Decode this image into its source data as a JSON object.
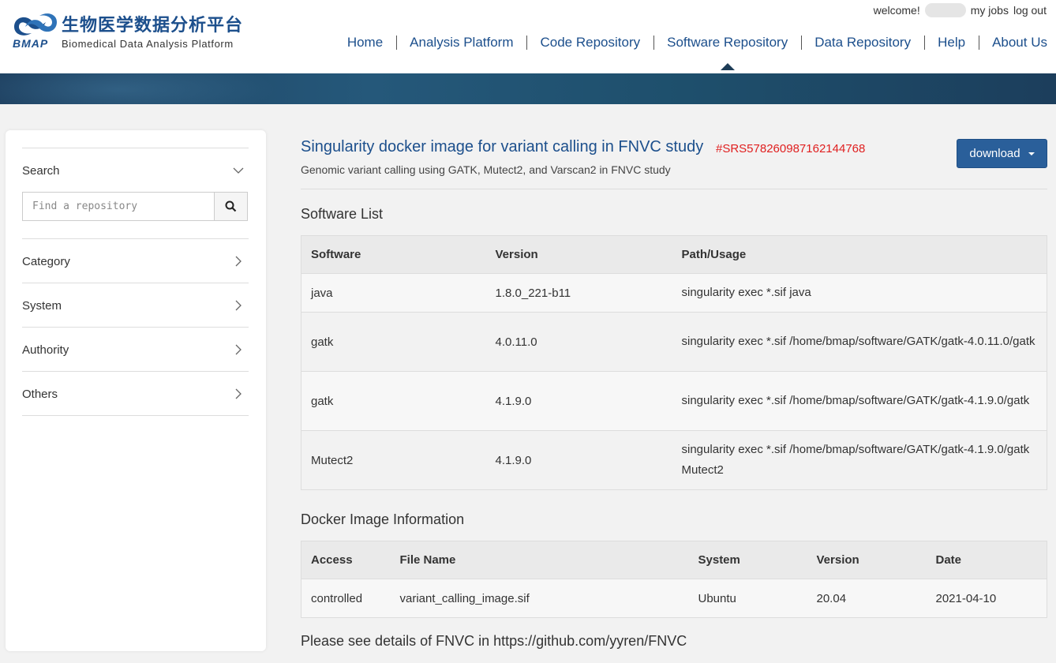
{
  "header": {
    "logo_cn": "生物医学数据分析平台",
    "logo_abbr": "BMAP",
    "logo_en": "Biomedical Data Analysis Platform",
    "welcome": "welcome!",
    "my_jobs": "my jobs",
    "log_out": "log out",
    "nav": [
      "Home",
      "Analysis Platform",
      "Code Repository",
      "Software Repository",
      "Data Repository",
      "Help",
      "About Us"
    ],
    "active_nav": "Software Repository"
  },
  "sidebar": {
    "search_label": "Search",
    "search_placeholder": "Find a repository",
    "filters": [
      "Category",
      "System",
      "Authority",
      "Others"
    ]
  },
  "main": {
    "title": "Singularity docker image for variant calling in FNVC study",
    "id": "#SRS578260987162144768",
    "subtitle": "Genomic variant calling using GATK, Mutect2, and Varscan2 in FNVC study",
    "download_label": "download",
    "software_list_title": "Software List",
    "software_headers": [
      "Software",
      "Version",
      "Path/Usage"
    ],
    "software_rows": [
      {
        "software": "java",
        "version": "1.8.0_221-b11",
        "path": "singularity exec *.sif java"
      },
      {
        "software": "gatk",
        "version": "4.0.11.0",
        "path": "singularity exec *.sif /home/bmap/software/GATK/gatk-4.0.11.0/gatk"
      },
      {
        "software": "gatk",
        "version": "4.1.9.0",
        "path": "singularity exec *.sif /home/bmap/software/GATK/gatk-4.1.9.0/gatk"
      },
      {
        "software": "Mutect2",
        "version": "4.1.9.0",
        "path": "singularity exec *.sif /home/bmap/software/GATK/gatk-4.1.9.0/gatk Mutect2"
      }
    ],
    "docker_title": "Docker Image Information",
    "docker_headers": [
      "Access",
      "File Name",
      "System",
      "Version",
      "Date"
    ],
    "docker_row": {
      "access": "controlled",
      "file_name": "variant_calling_image.sif",
      "system": "Ubuntu",
      "version": "20.04",
      "date": "2021-04-10"
    },
    "footer_note": "Please see details of FNVC in https://github.com/yyren/FNVC"
  },
  "colors": {
    "brand_blue": "#1c4f8c",
    "id_red": "#e02020",
    "button_blue": "#2a5f9a"
  }
}
